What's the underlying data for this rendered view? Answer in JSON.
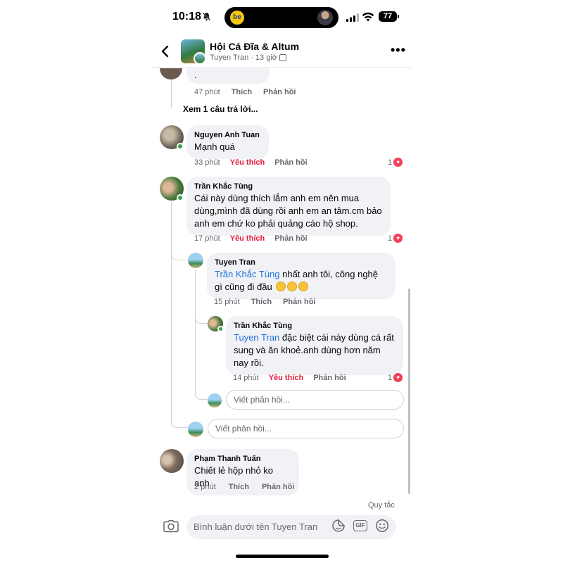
{
  "status_bar": {
    "time": "10:18",
    "battery": "77",
    "app_badge": "be"
  },
  "header": {
    "group_name": "Hội Cá Đĩa & Altum",
    "author": "Tuyen Tran",
    "separator": "·",
    "posted": "13 giờ"
  },
  "comments": {
    "top": {
      "text": ".",
      "time": "47 phút",
      "like": "Thích",
      "reply": "Phản hồi",
      "view_replies": "Xem 1 câu trả lời..."
    },
    "c1": {
      "name": "Nguyen Anh Tuan",
      "text": "Mạnh quá",
      "time": "33 phút",
      "like": "Yêu thích",
      "reply": "Phản hồi",
      "reactions": "1"
    },
    "c2": {
      "name": "Trần Khắc Tùng",
      "text": "Cái này dùng thích lắm anh em nên mua dùng,mình đã dùng rồi anh em an tâm.cm bảo anh em chứ ko phải quảng cáo hộ shop.",
      "time": "17 phút",
      "like": "Yêu thích",
      "reply": "Phản hồi",
      "reactions": "1",
      "r1": {
        "name": "Tuyen Tran",
        "mention": "Trần Khắc Tùng",
        "text": " nhất anh tôi, công nghệ gì cũng đi đầu",
        "time": "15 phút",
        "like": "Thích",
        "reply": "Phản hồi"
      },
      "r2": {
        "name": "Trần Khắc Tùng",
        "mention": "Tuyen Tran",
        "text": " đặc biệt cái này dùng cá rất sung và ăn khoẻ.anh dùng hơn năm nay rồi.",
        "time": "14 phút",
        "like": "Yêu thích",
        "reply": "Phản hồi",
        "reactions": "1"
      },
      "reply_placeholder_nested": "Viết phản hồi...",
      "reply_placeholder": "Viết phản hồi..."
    },
    "c3": {
      "name": "Phạm Thanh Tuấn",
      "text": "Chiết lẻ hộp nhỏ ko anh",
      "time": "2 phút",
      "like": "Thích",
      "reply": "Phản hồi"
    }
  },
  "footer": {
    "rules": "Quy tắc",
    "composer_placeholder": "Bình luận dưới tên Tuyen Tran",
    "gif_label": "GIF"
  },
  "colors": {
    "like_active": "#e41e3f",
    "mention": "#216fdb",
    "bubble": "#f0f2f5",
    "heart": "#f33e58",
    "online": "#31a24c"
  },
  "icons": [
    "bell-mute-icon",
    "signal-icon",
    "wifi-icon",
    "battery-icon",
    "back-icon",
    "more-icon",
    "privacy-icon",
    "heart-reaction-icon",
    "camera-icon",
    "sticker-icon",
    "gif-icon",
    "emoji-icon"
  ]
}
